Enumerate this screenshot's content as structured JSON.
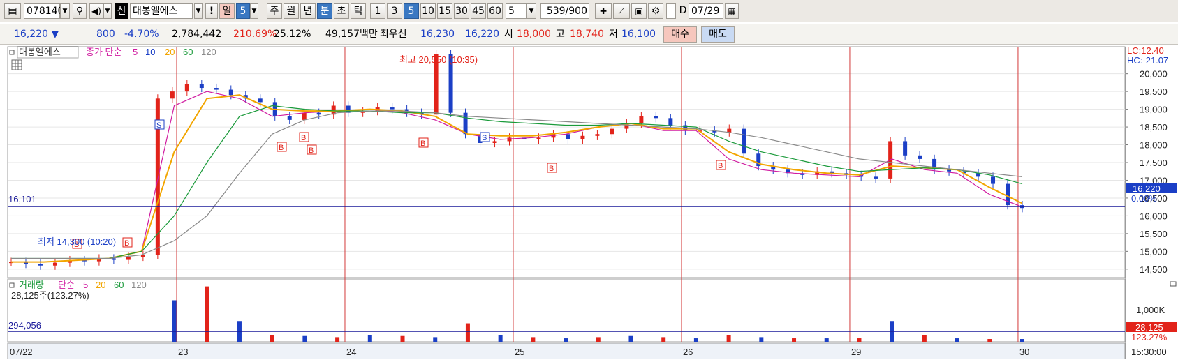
{
  "toolbar": {
    "code": "078140",
    "badge": "신",
    "name": "대봉엘에스",
    "alert": "!",
    "period_buttons": [
      "일",
      "5",
      "주",
      "월",
      "년",
      "분",
      "초",
      "틱"
    ],
    "minute_buttons": [
      "1",
      "3",
      "5",
      "10",
      "15",
      "30",
      "45",
      "60"
    ],
    "interval_value": "5",
    "count_value": "539",
    "count_total": "/900",
    "checkbox_label": "D",
    "date_value": "07/29"
  },
  "quote": {
    "price": "16,220",
    "arrow": "▼",
    "change": "800",
    "change_pct": "-4.70%",
    "volume": "2,784,442",
    "vol_ratio": "210.69%",
    "turnover": "25.12%",
    "amount": "49,157백만",
    "best_label": "최우선",
    "best_ask": "16,230",
    "best_bid": "16,220",
    "open_label": "시",
    "open": "18,000",
    "high_label": "고",
    "high": "18,740",
    "low_label": "저",
    "low": "16,100",
    "buy_label": "매수",
    "sell_label": "매도"
  },
  "price_panel": {
    "stock_label": "대봉엘에스",
    "ma_title": "종가 단순",
    "ma_periods": [
      "5",
      "10",
      "20",
      "60",
      "120"
    ],
    "ma_colors": [
      "#d01aa0",
      "#1b3fc6",
      "#f2a500",
      "#1a9a3a",
      "#8a8a8a"
    ],
    "high_annotation": "최고 20,550 (10:35)",
    "low_annotation": "최저 14,300 (10:20)",
    "lc_label": "LC:12.40",
    "hc_label": "HC:-21.07",
    "ref_line_label": "16,101",
    "current_tag": "16,220",
    "current_pct": "0.00%",
    "y_ticks": [
      "20,000",
      "19,500",
      "19,000",
      "18,500",
      "18,000",
      "17,500",
      "17,000",
      "16,500",
      "16,000",
      "15,500",
      "15,000",
      "14,500"
    ]
  },
  "volume_panel": {
    "title": "거래량",
    "ma_title": "단순",
    "ma_periods": [
      "5",
      "20",
      "60",
      "120"
    ],
    "ma_colors": [
      "#d01aa0",
      "#f2a500",
      "#1a9a3a",
      "#8a8a8a"
    ],
    "last_volume": "28,125주(123.27%)",
    "ref_line_label": "294,056",
    "y_tick": "1,000K",
    "current_tag": "28,125",
    "current_pct": "123.27%"
  },
  "x_axis": {
    "labels": [
      "07/22",
      "23",
      "24",
      "25",
      "26",
      "29",
      "30"
    ],
    "end_time": "15:30:00"
  },
  "signal_markers": [
    "S",
    "S",
    "B",
    "B",
    "B",
    "B",
    "B",
    "B",
    "B",
    "B"
  ],
  "chart_data": {
    "type": "candlestick",
    "sessions": [
      "07/22",
      "23",
      "24",
      "25",
      "26",
      "29",
      "30"
    ],
    "ylim": [
      14300,
      20700
    ],
    "price_trace_close": [
      14700,
      14650,
      14600,
      14680,
      14750,
      14720,
      14800,
      14760,
      14850,
      14900,
      19300,
      19500,
      19700,
      19600,
      19550,
      19400,
      19300,
      19200,
      18800,
      18700,
      18900,
      18850,
      19100,
      18900,
      18950,
      19050,
      19000,
      18900,
      18850,
      20550,
      18900,
      18300,
      18050,
      18100,
      18200,
      18150,
      18200,
      18300,
      18150,
      18250,
      18300,
      18450,
      18600,
      18800,
      18750,
      18550,
      18400,
      18400,
      18350,
      18450,
      17750,
      17400,
      17300,
      17200,
      17150,
      17250,
      17200,
      17150,
      17100,
      17050,
      18100,
      17700,
      17600,
      17300,
      17250,
      17200,
      17100,
      16900,
      16300,
      16220
    ],
    "ma_lines": [
      {
        "name": "5",
        "points": [
          14700,
          14700,
          14750,
          14800,
          15000,
          19100,
          19500,
          19300,
          18800,
          18900,
          18950,
          19000,
          18900,
          18700,
          18300,
          18150,
          18200,
          18300,
          18500,
          18600,
          18400,
          18400,
          17600,
          17300,
          17200,
          17150,
          17100,
          17600,
          17300,
          17200,
          16600,
          16250
        ]
      },
      {
        "name": "20",
        "points": [
          14700,
          14700,
          14750,
          14800,
          15000,
          17800,
          19300,
          19400,
          19000,
          18950,
          18950,
          19000,
          18950,
          18800,
          18300,
          18250,
          18250,
          18350,
          18500,
          18600,
          18450,
          18450,
          17800,
          17450,
          17300,
          17200,
          17150,
          17400,
          17350,
          17300,
          16800,
          16350
        ]
      },
      {
        "name": "60",
        "points": [
          14800,
          14800,
          14800,
          14800,
          15000,
          16000,
          17500,
          18800,
          19100,
          19000,
          18950,
          18950,
          18900,
          18900,
          18750,
          18650,
          18600,
          18550,
          18550,
          18600,
          18550,
          18500,
          18100,
          17800,
          17600,
          17400,
          17250,
          17300,
          17350,
          17300,
          17150,
          16900
        ]
      },
      {
        "name": "120",
        "points": [
          14800,
          14800,
          14800,
          14800,
          14900,
          15300,
          16000,
          17200,
          18300,
          18700,
          18900,
          18950,
          18950,
          18900,
          18800,
          18750,
          18700,
          18650,
          18600,
          18550,
          18500,
          18450,
          18350,
          18200,
          18000,
          17800,
          17600,
          17500,
          17400,
          17300,
          17200,
          17100
        ]
      }
    ],
    "volume_peaks": [
      0,
      0,
      0,
      0,
      0,
      1800,
      2400,
      900,
      300,
      250,
      200,
      300,
      250,
      200,
      800,
      300,
      200,
      150,
      200,
      250,
      200,
      150,
      300,
      200,
      150,
      150,
      150,
      900,
      300,
      150,
      120,
      120
    ]
  }
}
